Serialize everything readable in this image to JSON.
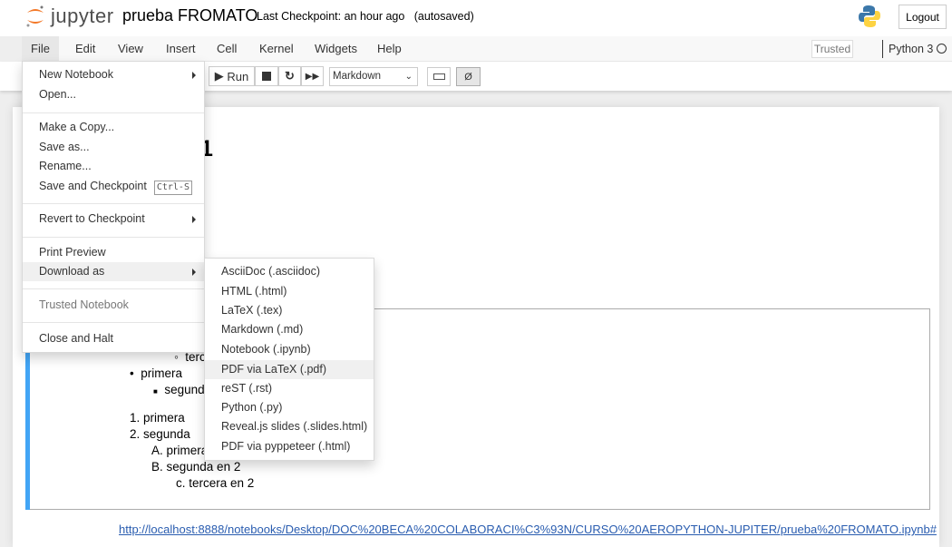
{
  "header": {
    "logo_text": "jupyter",
    "notebook_name": "prueba FROMATO",
    "checkpoint": "Last Checkpoint: an hour ago",
    "autosave": "(autosaved)",
    "logout": "Logout"
  },
  "menubar": {
    "items": [
      "File",
      "Edit",
      "View",
      "Insert",
      "Cell",
      "Kernel",
      "Widgets",
      "Help"
    ],
    "trusted": "Trusted",
    "kernel": "Python 3"
  },
  "toolbar": {
    "run": "Run",
    "cell_type": "Markdown"
  },
  "file_menu": {
    "items": [
      {
        "label": "New Notebook",
        "submenu": true
      },
      {
        "label": "Open..."
      },
      {
        "label": "Make a Copy..."
      },
      {
        "label": "Save as..."
      },
      {
        "label": "Rename..."
      },
      {
        "label": "Save and Checkpoint",
        "shortcut": "Ctrl-S"
      },
      {
        "label": "Revert to Checkpoint",
        "submenu": true
      },
      {
        "label": "Print Preview"
      },
      {
        "label": "Download as",
        "submenu": true,
        "highlighted": true
      },
      {
        "label": "Trusted Notebook",
        "disabled": true
      },
      {
        "label": "Close and Halt"
      }
    ]
  },
  "download_menu": {
    "items": [
      "AsciiDoc (.asciidoc)",
      "HTML (.html)",
      "LaTeX (.tex)",
      "Markdown (.md)",
      "Notebook (.ipynb)",
      "PDF via LaTeX (.pdf)",
      "reST (.rst)",
      "Python (.py)",
      "Reveal.js slides (.slides.html)",
      "PDF via pyppeteer (.html)"
    ],
    "highlighted": "PDF via LaTeX (.pdf)"
  },
  "notebook": {
    "heading_fragment": "1",
    "list": {
      "partial_tercera": "terc",
      "b1": "primera",
      "b2": "segunda",
      "o1": "1. primera",
      "o2": "2. segunda",
      "oa": "A. primera",
      "ob": "B. segunda en 2",
      "oc": "c. tercera en 2"
    },
    "link": "http://localhost:8888/notebooks/Desktop/DOC%20BECA%20COLABORACI%C3%93N/CURSO%20AEROPYTHON-JUPITER/prueba%20FROMATO.ipynb#"
  },
  "colors": {
    "accent_blue": "#42a5f5",
    "jupyter_orange": "#f37726",
    "link": "#2a5db0"
  }
}
